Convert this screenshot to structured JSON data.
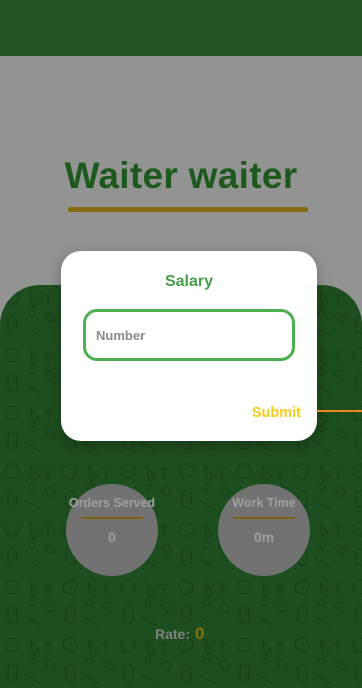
{
  "app": {
    "title": "Waiter waiter"
  },
  "stats": {
    "orders_served": {
      "label": "Orders Served",
      "value": "0"
    },
    "work_time": {
      "label": "Work Time",
      "value": "0m"
    }
  },
  "rate": {
    "label": "Rate:",
    "value": "0"
  },
  "dialog": {
    "title": "Salary",
    "input_placeholder": "Number",
    "input_value": "",
    "submit_label": "Submit"
  },
  "colors": {
    "primary_green": "#3a8a3a",
    "accent_gold": "#d8ad18",
    "submit_yellow": "#f2cd17",
    "input_border": "#4caf50"
  }
}
